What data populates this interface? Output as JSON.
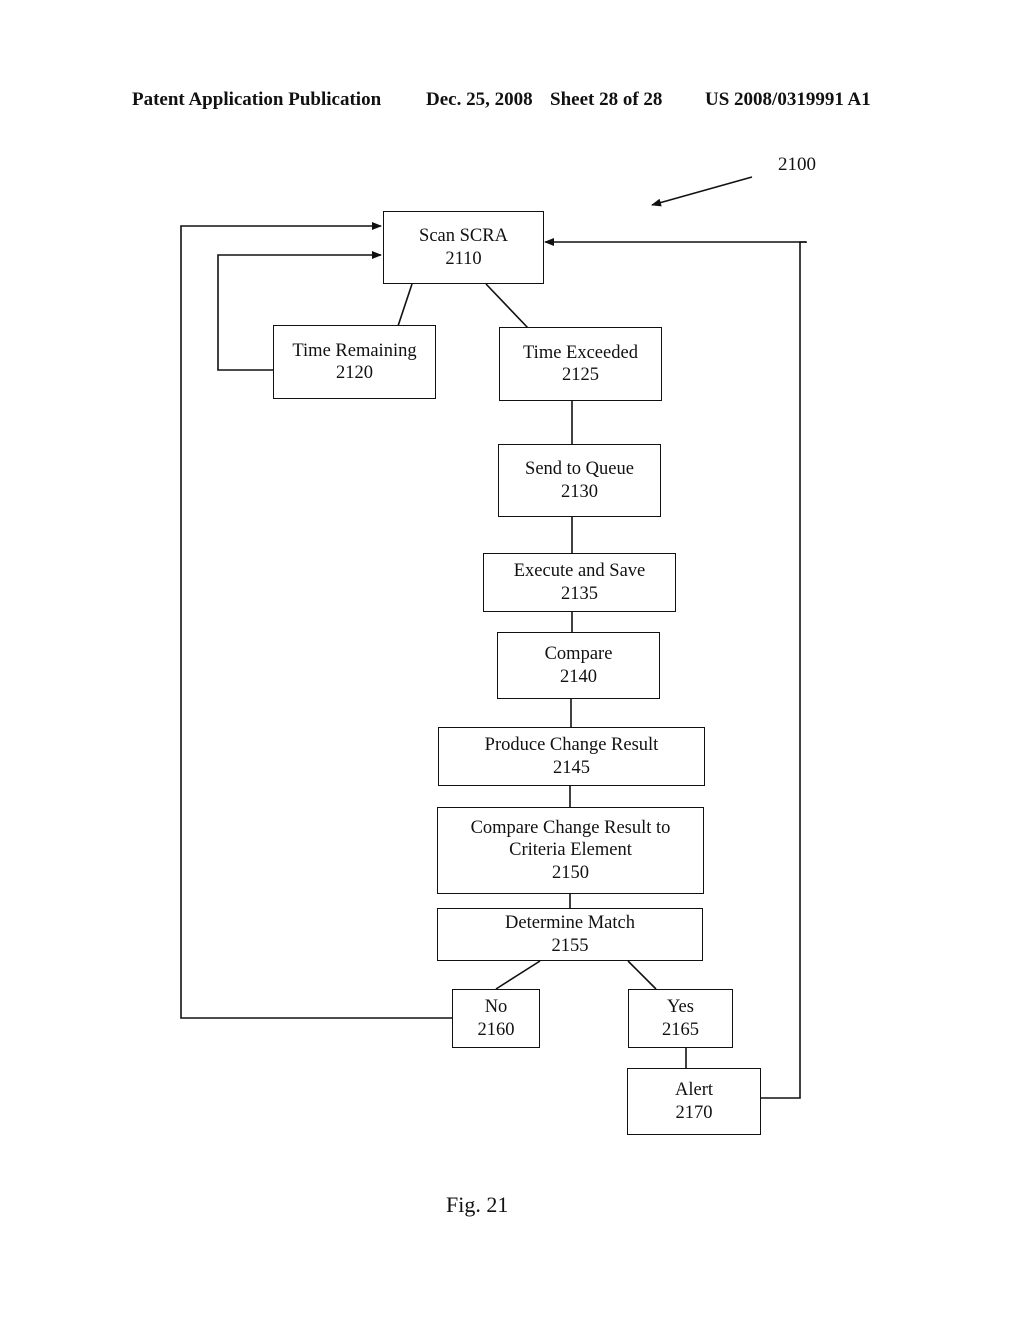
{
  "header": {
    "left": "Patent Application Publication",
    "date": "Dec. 25, 2008",
    "sheet": "Sheet 28 of 28",
    "number": "US 2008/0319991 A1"
  },
  "figure": {
    "reference": "2100",
    "caption": "Fig. 21"
  },
  "nodes": {
    "scan": {
      "label": "Scan SCRA",
      "id": "2110"
    },
    "time_remaining": {
      "label": "Time Remaining",
      "id": "2120"
    },
    "time_exceeded": {
      "label": "Time Exceeded",
      "id": "2125"
    },
    "send_queue": {
      "label": "Send to Queue",
      "id": "2130"
    },
    "execute_save": {
      "label": "Execute and Save",
      "id": "2135"
    },
    "compare": {
      "label": "Compare",
      "id": "2140"
    },
    "produce_change": {
      "label": "Produce Change Result",
      "id": "2145"
    },
    "compare_criteria": {
      "label_line1": "Compare Change Result to",
      "label_line2": "Criteria Element",
      "id": "2150"
    },
    "determine_match": {
      "label": "Determine Match",
      "id": "2155"
    },
    "no": {
      "label": "No",
      "id": "2160"
    },
    "yes": {
      "label": "Yes",
      "id": "2165"
    },
    "alert": {
      "label": "Alert",
      "id": "2170"
    }
  },
  "edges": [
    {
      "from": "2110",
      "to": "2120"
    },
    {
      "from": "2110",
      "to": "2125"
    },
    {
      "from": "2120",
      "to": "2110",
      "arrow": true
    },
    {
      "from": "2125",
      "to": "2130"
    },
    {
      "from": "2130",
      "to": "2135"
    },
    {
      "from": "2135",
      "to": "2140"
    },
    {
      "from": "2140",
      "to": "2145"
    },
    {
      "from": "2145",
      "to": "2150"
    },
    {
      "from": "2150",
      "to": "2155"
    },
    {
      "from": "2155",
      "to": "2160"
    },
    {
      "from": "2155",
      "to": "2165"
    },
    {
      "from": "2165",
      "to": "2170"
    },
    {
      "from": "2160",
      "to": "2110",
      "arrow": true
    },
    {
      "from": "2170",
      "to": "2110",
      "arrow": true
    }
  ]
}
